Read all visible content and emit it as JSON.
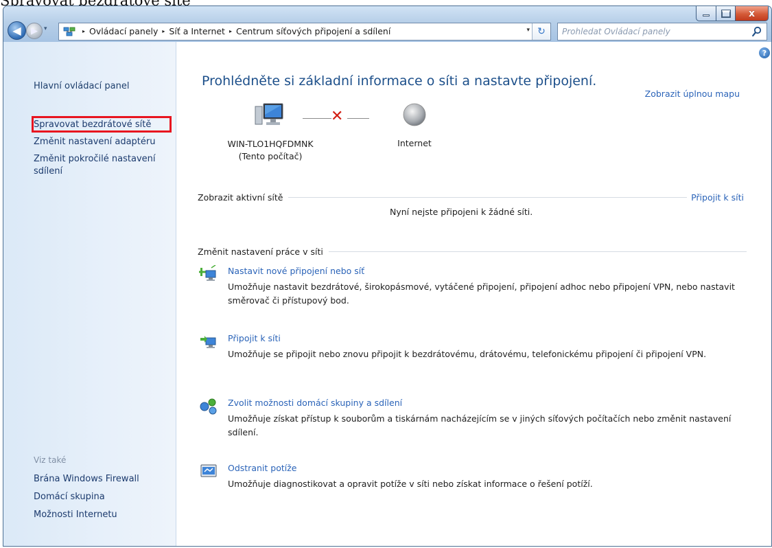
{
  "doc_caption": "Spravovat bezdrátové sítě",
  "window": {
    "minimize_glyph": "_",
    "close_glyph": "x"
  },
  "address": {
    "history_glyph": "▾",
    "crumbs": [
      "Ovládací panely",
      "Síť a Internet",
      "Centrum síťových připojení a sdílení"
    ],
    "separator": "▸",
    "dropdown_glyph": "▾",
    "refresh_glyph": "↻"
  },
  "search": {
    "placeholder": "Prohledat Ovládací panely"
  },
  "sidebar": {
    "main_link": "Hlavní ovládací panel",
    "links": [
      "Spravovat bezdrátové sítě",
      "Změnit nastavení adaptéru",
      "Změnit pokročilé nastavení sdílení"
    ],
    "see_also_label": "Viz také",
    "see_also": [
      "Brána Windows Firewall",
      "Domácí skupina",
      "Možnosti Internetu"
    ]
  },
  "main": {
    "help_glyph": "?",
    "title": "Prohlédněte si základní informace o síti a nastavte připojení.",
    "full_map_link": "Zobrazit úplnou mapu",
    "computer_name": "WIN-TLO1HQFDMNK",
    "computer_sub": "(Tento počítač)",
    "internet_label": "Internet",
    "broken_glyph": "✕",
    "active_networks_label": "Zobrazit aktivní sítě",
    "connect_link": "Připojit k síti",
    "no_network_text": "Nyní nejste připojeni k žádné síti.",
    "settings_label": "Změnit nastavení práce v síti",
    "tasks": [
      {
        "icon": "network-setup-icon",
        "title": "Nastavit nové připojení nebo síť",
        "desc": "Umožňuje nastavit bezdrátové, širokopásmové, vytáčené připojení, připojení adhoc nebo připojení VPN, nebo nastavit směrovač či přístupový bod."
      },
      {
        "icon": "connect-network-icon",
        "title": "Připojit k síti",
        "desc": "Umožňuje se připojit nebo znovu připojit k bezdrátovému, drátovému, telefonickému připojení či připojení VPN."
      },
      {
        "icon": "homegroup-icon",
        "title": "Zvolit možnosti domácí skupiny a sdílení",
        "desc": "Umožňuje získat přístup k souborům a tiskárnám nacházejícím se v jiných síťových počítačích nebo změnit nastavení sdílení."
      },
      {
        "icon": "troubleshoot-icon",
        "title": "Odstranit potíže",
        "desc": "Umožňuje diagnostikovat a opravit potíže v síti nebo získat informace o řešení potíží."
      }
    ]
  },
  "colors": {
    "link": "#2a63b8",
    "title": "#1c4f8a",
    "highlight": "#e8141f",
    "error_x": "#d21d12"
  }
}
